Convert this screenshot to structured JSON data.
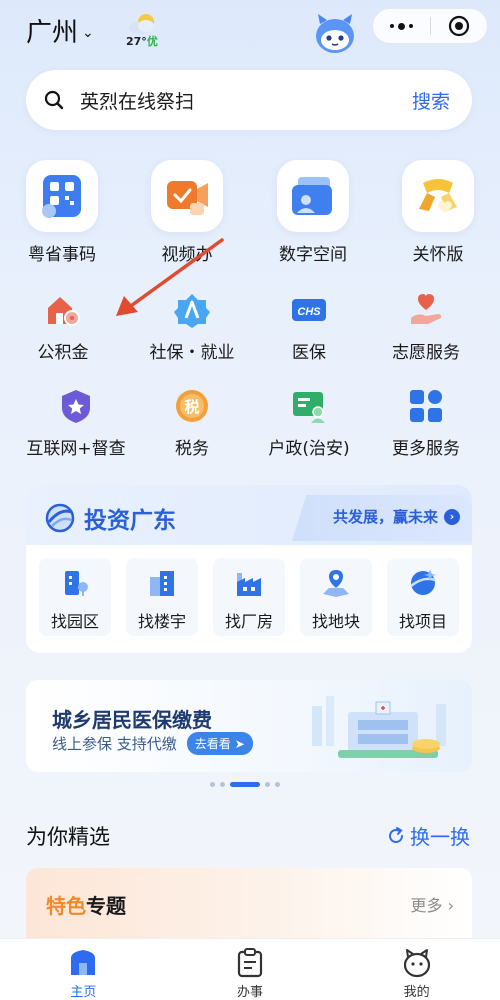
{
  "header": {
    "city": "广州",
    "temperature": "27°",
    "air_quality": "优"
  },
  "search": {
    "query": "英烈在线祭扫",
    "button": "搜索"
  },
  "quick_services": [
    {
      "label": "粤省事码",
      "icon": "qr-code-icon"
    },
    {
      "label": "视频办",
      "icon": "video-office-icon"
    },
    {
      "label": "数字空间",
      "icon": "digital-space-icon"
    },
    {
      "label": "关怀版",
      "icon": "care-version-icon"
    }
  ],
  "services": [
    {
      "label": "公积金",
      "icon": "housing-fund-icon"
    },
    {
      "label": "社保・就业",
      "icon": "social-security-icon"
    },
    {
      "label": "医保",
      "icon": "medical-insurance-icon",
      "badge": "CHS"
    },
    {
      "label": "志愿服务",
      "icon": "volunteer-icon"
    },
    {
      "label": "互联网+督查",
      "icon": "supervision-icon"
    },
    {
      "label": "税务",
      "icon": "tax-icon",
      "badge": "税"
    },
    {
      "label": "户政(治安)",
      "icon": "household-icon"
    },
    {
      "label": "更多服务",
      "icon": "more-services-icon"
    }
  ],
  "invest": {
    "title": "投资广东",
    "slogan": "共发展，赢未来",
    "items": [
      {
        "label": "找园区",
        "icon": "park-icon"
      },
      {
        "label": "找楼宇",
        "icon": "building-icon"
      },
      {
        "label": "找厂房",
        "icon": "factory-icon"
      },
      {
        "label": "找地块",
        "icon": "land-icon"
      },
      {
        "label": "找项目",
        "icon": "project-icon"
      }
    ]
  },
  "banner": {
    "title": "城乡居民医保缴费",
    "subtitle": "线上参保 支持代缴",
    "cta": "去看看"
  },
  "carousel": {
    "count": 5,
    "active_index": 2
  },
  "recommend": {
    "title": "为你精选",
    "refresh": "换一换"
  },
  "topic": {
    "title_a": "特色",
    "title_b": "专题",
    "more": "更多"
  },
  "tabbar": [
    {
      "label": "主页",
      "icon": "home-icon",
      "active": true
    },
    {
      "label": "办事",
      "icon": "clipboard-icon",
      "active": false
    },
    {
      "label": "我的",
      "icon": "profile-icon",
      "active": false
    }
  ],
  "colors": {
    "accent": "#2d6cf0",
    "annotation_arrow": "#e04a2f"
  }
}
